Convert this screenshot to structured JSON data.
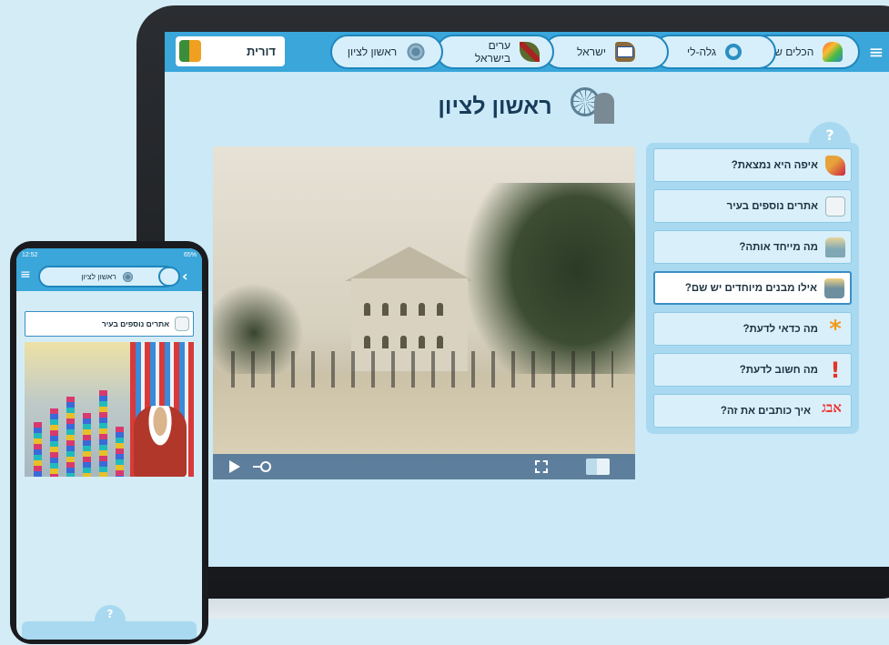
{
  "tablet": {
    "nav": {
      "menu_icon": "hamburger-icon",
      "tabs": [
        {
          "label": "הכלים שלי",
          "icon": "hand-icon"
        },
        {
          "label": "גלה-לי",
          "icon": "search-icon"
        },
        {
          "label": "ישראל",
          "icon": "map-flag-icon"
        },
        {
          "label": "ערים בישראל",
          "icon": "feather-icon"
        },
        {
          "label": "ראשון לציון",
          "icon": "ferris-wheel-icon"
        }
      ],
      "username": "דורית"
    },
    "page_title": "ראשון לציון",
    "help_symbol": "?",
    "questions": [
      {
        "label": "איפה היא נמצאת?",
        "icon": "question-feather-icon"
      },
      {
        "label": "אתרים נוספים בעיר",
        "icon": "sites-icon"
      },
      {
        "label": "מה מייחד אותה?",
        "icon": "skyline-icon"
      },
      {
        "label": "אילו מבנים מיוחדים יש שם?",
        "icon": "buildings-icon",
        "selected": true
      },
      {
        "label": "מה כדאי לדעת?",
        "icon": "asterisk-icon",
        "glyph": "*"
      },
      {
        "label": "מה חשוב לדעת?",
        "icon": "exclamation-icon",
        "glyph": "!"
      },
      {
        "label": "איך כותבים את זה?",
        "icon": "alef-bet-icon",
        "glyph": "אבג"
      }
    ]
  },
  "phone": {
    "status": {
      "time": "12:52",
      "battery": "65%"
    },
    "tab_label": "ראשון לציון",
    "back_glyph": "›",
    "menu_glyph": "≡",
    "question_label": "אתרים נוספים בעיר",
    "help_symbol": "?"
  },
  "colors": {
    "accent": "#3aa6da",
    "tab_border": "#1f86bd",
    "panel": "#a8d9f0",
    "background": "#cbe9f7"
  }
}
